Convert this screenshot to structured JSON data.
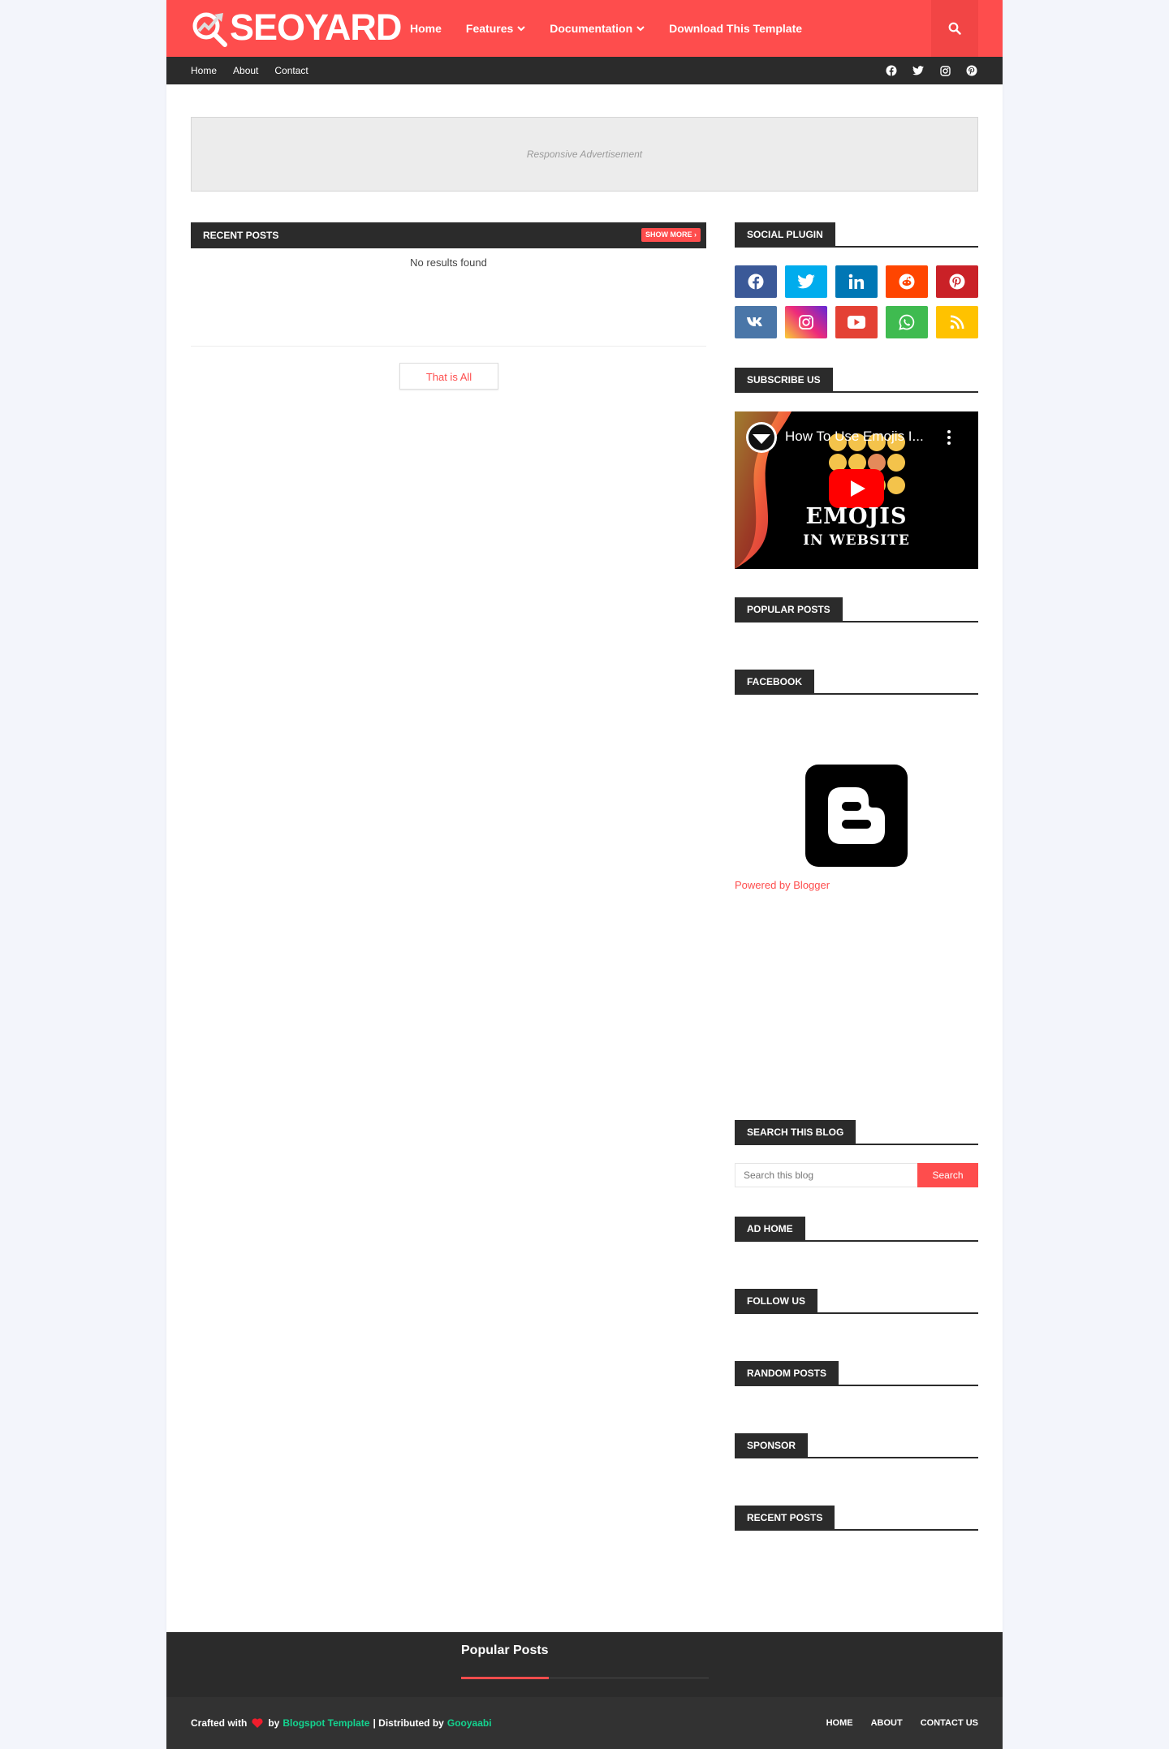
{
  "header": {
    "logo_text": "SEOYARD",
    "nav": [
      {
        "label": "Home",
        "has_dropdown": false
      },
      {
        "label": "Features",
        "has_dropdown": true
      },
      {
        "label": "Documentation",
        "has_dropdown": true
      },
      {
        "label": "Download This Template",
        "has_dropdown": false
      }
    ],
    "search_icon": "search-icon",
    "accent_color": "#fe4d4d"
  },
  "subbar": {
    "links": [
      "Home",
      "About",
      "Contact"
    ],
    "social_icons": [
      "facebook-icon",
      "twitter-icon",
      "instagram-icon",
      "pinterest-icon"
    ]
  },
  "ad": {
    "text": "Responsive Advertisement"
  },
  "main": {
    "recent_posts": {
      "title": "RECENT POSTS",
      "show_more": "SHOW MORE",
      "empty_text": "No results found"
    },
    "that_is_all": "That is All"
  },
  "sidebar": {
    "social_plugin": {
      "title": "SOCIAL PLUGIN",
      "buttons": [
        {
          "icon": "facebook-icon",
          "color": "#3b5998"
        },
        {
          "icon": "twitter-icon",
          "color": "#00aced"
        },
        {
          "icon": "linkedin-icon",
          "color": "#0077b5"
        },
        {
          "icon": "reddit-icon",
          "color": "#ff4500"
        },
        {
          "icon": "pinterest-icon",
          "color": "#ca2127"
        },
        {
          "icon": "vk-icon",
          "color": "#4a76a8"
        },
        {
          "icon": "instagram-icon",
          "color": "#c536a4"
        },
        {
          "icon": "youtube-icon",
          "color": "#e44134"
        },
        {
          "icon": "whatsapp-icon",
          "color": "#3fbb50"
        },
        {
          "icon": "rss-icon",
          "color": "#ffc200"
        }
      ]
    },
    "subscribe": {
      "title": "SUBSCRIBE US",
      "video_title": "How To Use Emojis I...",
      "video_line1": "EMOJIS",
      "video_line2": "IN WEBSITE"
    },
    "popular_posts": {
      "title": "POPULAR POSTS"
    },
    "facebook": {
      "title": "FACEBOOK",
      "powered_by": "Powered by Blogger"
    },
    "search": {
      "title": "SEARCH THIS BLOG",
      "placeholder": "Search this blog",
      "button": "Search"
    },
    "ad_home": {
      "title": "AD HOME"
    },
    "follow_us": {
      "title": "FOLLOW US"
    },
    "random_posts": {
      "title": "RANDOM POSTS"
    },
    "sponsor": {
      "title": "SPONSOR"
    },
    "recent_posts": {
      "title": "RECENT POSTS"
    }
  },
  "footer": {
    "popular_posts_title": "Popular Posts",
    "credit_prefix": "Crafted with",
    "credit_by": "by",
    "credit_link1": "Blogspot Template",
    "credit_sep": "| Distributed by",
    "credit_link2": "Gooyaabi",
    "nav": [
      "HOME",
      "ABOUT",
      "CONTACT US"
    ]
  }
}
